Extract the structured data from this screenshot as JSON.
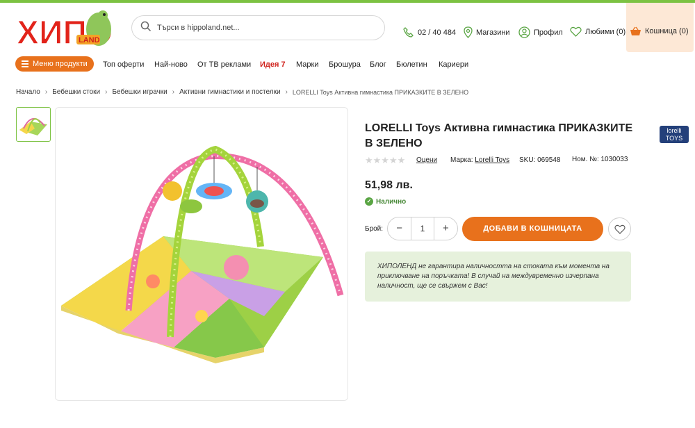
{
  "header": {
    "logo_text": "ХИПО",
    "logo_sub": "LAND",
    "search_placeholder": "Търси в hippoland.net...",
    "phone": "02 / 40 484",
    "stores": "Магазини",
    "profile": "Профил",
    "favorites": "Любими (0)",
    "cart": "Кошница (0)"
  },
  "nav": {
    "menu": "Меню продукти",
    "items": [
      "Топ оферти",
      "Най-ново",
      "От ТВ реклами",
      "Идея 7",
      "Марки",
      "Брошура",
      "Блог",
      "Бюлетин",
      "Кариери"
    ]
  },
  "breadcrumb": [
    "Начало",
    "Бебешки стоки",
    "Бебешки играчки",
    "Активни гимнастики и постелки",
    "LORELLI Toys Активна гимнастика ПРИКАЗКИТЕ В ЗЕЛЕНО"
  ],
  "product": {
    "title": "LORELLI Toys Активна гимнастика ПРИКАЗКИТЕ В ЗЕЛЕНО",
    "brand_logo_text": "lorelli TOYS",
    "stars": "★★★★★",
    "rating_label": "Оцени",
    "brand_label": "Марка:",
    "brand_name": "Lorelli Toys",
    "sku": "SKU: 069548",
    "number": "Ном. №: 1030033",
    "price": "51,98 лв.",
    "availability": "Налично",
    "qty_label": "Брой:",
    "qty_minus": "−",
    "qty_value": "1",
    "qty_plus": "+",
    "add_to_cart": "ДОБАВИ В КОШНИЦАТА",
    "notice": "ХИПОЛЕНД не гарантира наличността на стоката към момента на приключване на поръчката! В случай на междувременно изчерпана наличност, ще се свържем с Вас!"
  },
  "colors": {
    "accent": "#e8711c",
    "green": "#7cc242",
    "notice_bg": "#e6f1dc"
  }
}
